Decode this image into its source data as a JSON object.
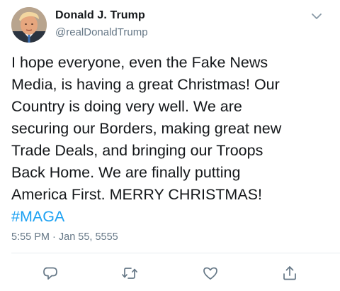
{
  "tweet": {
    "author_name": "Donald J. Trump",
    "author_handle": "@realDonaldTrump",
    "text": "I hope everyone, even the Fake News\nMedia, is having a great Christmas! Our\nCountry is doing very well. We are\nsecuring our Borders, making great new\nTrade Deals, and bringing our Troops\nBack Home. We are finally putting\nAmerica First. MERRY CHRISTMAS!",
    "hashtag": "#MAGA",
    "timestamp": "5:55 PM · Jan 55, 5555"
  },
  "icons": {
    "menu": "chevron-down-icon",
    "reply": "reply-icon",
    "retweet": "retweet-icon",
    "like": "heart-icon",
    "share": "share-icon"
  },
  "colors": {
    "text": "#14171a",
    "secondary": "#657786",
    "link": "#1da1f2",
    "divider": "#e6ecf0"
  }
}
